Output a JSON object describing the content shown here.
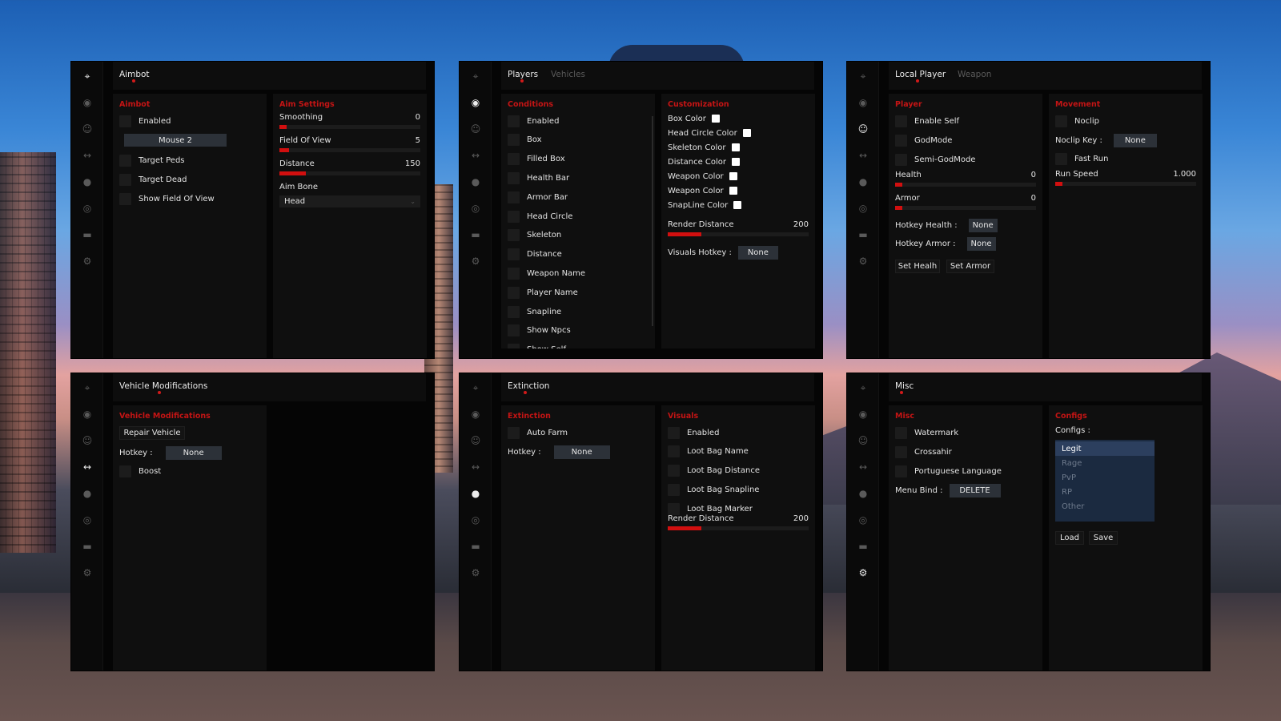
{
  "nav_icons": [
    "crosshair-icon",
    "eye-icon",
    "user-icon",
    "arrows-horizontal-icon",
    "bomb-icon",
    "globe-icon",
    "car-icon",
    "gear-icon"
  ],
  "aimbot": {
    "tab": "Aimbot",
    "left_title": "Aimbot",
    "enabled": "Enabled",
    "key_button": "Mouse 2",
    "target_peds": "Target Peds",
    "target_dead": "Target Dead",
    "show_fov": "Show Field Of View",
    "right_title": "Aim Settings",
    "sliders": [
      {
        "label": "Smoothing",
        "value": "0",
        "fraction": 0.05
      },
      {
        "label": "Field Of View",
        "value": "5",
        "fraction": 0.07
      },
      {
        "label": "Distance",
        "value": "150",
        "fraction": 0.19
      }
    ],
    "aim_bone_label": "Aim Bone",
    "aim_bone_value": "Head"
  },
  "visuals": {
    "tab_active": "Players",
    "tab_inactive": "Vehicles",
    "conditions_title": "Conditions",
    "conditions": [
      "Enabled",
      "Box",
      "Filled Box",
      "Health Bar",
      "Armor Bar",
      "Head Circle",
      "Skeleton",
      "Distance",
      "Weapon Name",
      "Player Name",
      "Snapline",
      "Show Npcs",
      "Show Self"
    ],
    "custom_title": "Customization",
    "colors": [
      "Box Color",
      "Head Circle Color",
      "Skeleton Color",
      "Distance Color",
      "Weapon Color",
      "Weapon Color",
      "SnapLine Color"
    ],
    "render_label": "Render Distance",
    "render_value": "200",
    "render_fraction": 0.24,
    "hotkey_label": "Visuals Hotkey :",
    "hotkey_value": "None"
  },
  "local": {
    "tab_active": "Local Player",
    "tab_inactive": "Weapon",
    "player_title": "Player",
    "enable_self": "Enable Self",
    "godmode": "GodMode",
    "semi_godmode": "Semi-GodMode",
    "health_label": "Health",
    "health_value": "0",
    "health_fraction": 0.05,
    "armor_label": "Armor",
    "armor_value": "0",
    "armor_fraction": 0.05,
    "hotkey_health_label": "Hotkey Health :",
    "hotkey_health_value": "None",
    "hotkey_armor_label": "Hotkey Armor :",
    "hotkey_armor_value": "None",
    "set_health": "Set Healh",
    "set_armor": "Set Armor",
    "movement_title": "Movement",
    "noclip": "Noclip",
    "noclip_key_label": "Noclip Key :",
    "noclip_key_value": "None",
    "fast_run": "Fast Run",
    "run_speed_label": "Run Speed",
    "run_speed_value": "1.000",
    "run_speed_fraction": 0.05
  },
  "vehicle": {
    "tab": "Vehicle Modifications",
    "title": "Vehicle Modifications",
    "repair": "Repair Vehicle",
    "hotkey_label": "Hotkey :",
    "hotkey_value": "None",
    "boost": "Boost"
  },
  "extinction": {
    "tab": "Extinction",
    "title": "Extinction",
    "auto_farm": "Auto Farm",
    "hotkey_label": "Hotkey :",
    "hotkey_value": "None",
    "visuals_title": "Visuals",
    "visuals": [
      "Enabled",
      "Loot Bag Name",
      "Loot Bag Distance",
      "Loot Bag Snapline",
      "Loot Bag Marker"
    ],
    "render_label": "Render Distance",
    "render_value": "200",
    "render_fraction": 0.24
  },
  "misc": {
    "tab": "Misc",
    "title": "Misc",
    "watermark": "Watermark",
    "crosshair": "Crossahir",
    "portuguese": "Portuguese Language",
    "menu_bind_label": "Menu Bind :",
    "menu_bind_value": "DELETE",
    "configs_title": "Configs",
    "configs_label": "Configs :",
    "configs": [
      "Legit",
      "Rage",
      "PvP",
      "RP",
      "Other"
    ],
    "selected_config": "Legit",
    "load": "Load",
    "save": "Save"
  }
}
